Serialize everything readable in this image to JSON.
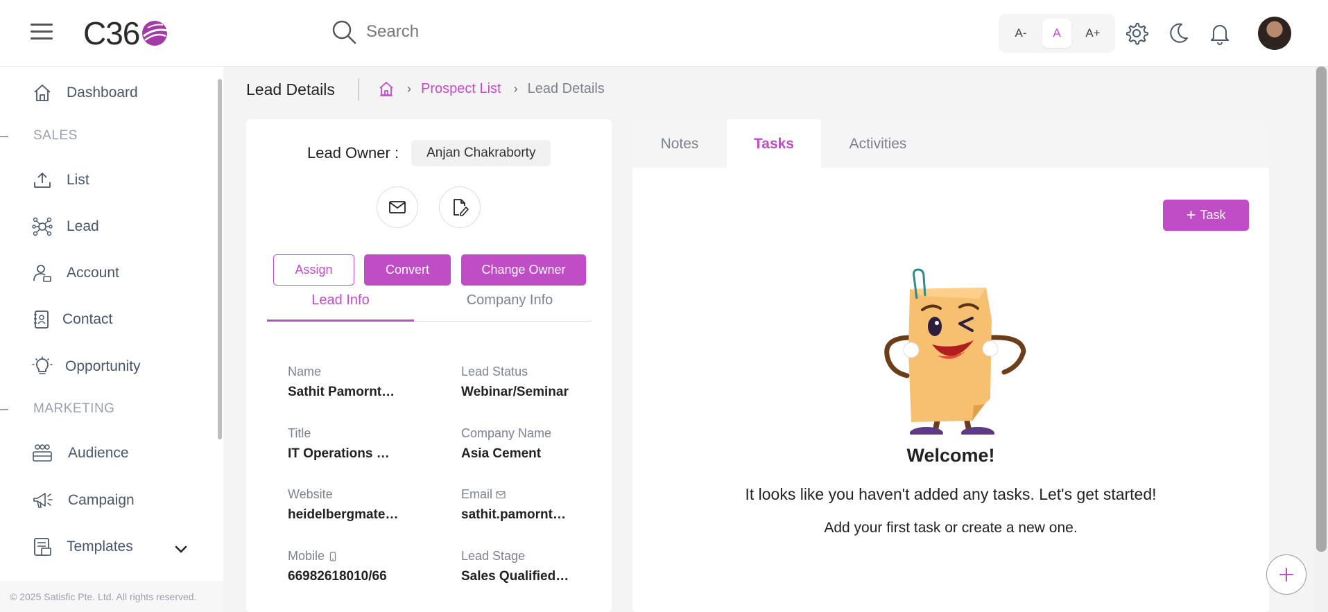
{
  "header": {
    "logo_text": "C36",
    "search_placeholder": "Search",
    "font_small": "A-",
    "font_normal": "A",
    "font_large": "A+"
  },
  "sidebar": {
    "items": [
      {
        "label": "Dashboard",
        "icon": "home-icon"
      },
      {
        "label": "List",
        "icon": "upload-icon"
      },
      {
        "label": "Lead",
        "icon": "lead-network-icon"
      },
      {
        "label": "Account",
        "icon": "account-icon"
      },
      {
        "label": "Contact",
        "icon": "contact-icon"
      },
      {
        "label": "Opportunity",
        "icon": "bulb-icon"
      },
      {
        "label": "Audience",
        "icon": "audience-icon"
      },
      {
        "label": "Campaign",
        "icon": "megaphone-icon"
      },
      {
        "label": "Templates",
        "icon": "templates-icon"
      }
    ],
    "sections": [
      "SALES",
      "MARKETING"
    ],
    "footer": "© 2025 Satisfic Pte. Ltd. All rights reserved."
  },
  "page": {
    "title": "Lead Details",
    "breadcrumb": [
      "Prospect List",
      "Lead Details"
    ]
  },
  "lead": {
    "owner_label": "Lead Owner :",
    "owner_name": "Anjan Chakraborty",
    "buttons": {
      "assign": "Assign",
      "convert": "Convert",
      "change_owner": "Change Owner"
    },
    "tabs": [
      "Lead Info",
      "Company Info"
    ],
    "fields": [
      {
        "label": "Name",
        "value": "Sathit Pamorntanaporn"
      },
      {
        "label": "Lead Status",
        "value": "Webinar/Seminar"
      },
      {
        "label": "Title",
        "value": "IT Operations Manager"
      },
      {
        "label": "Company Name",
        "value": "Asia Cement"
      },
      {
        "label": "Website",
        "value": "heidelbergmaterials.com"
      },
      {
        "label": "Email",
        "value": "sathit.pamorntanaporn"
      },
      {
        "label": "Mobile",
        "value": "66982618010/66"
      },
      {
        "label": "Lead Stage",
        "value": "Sales Qualified Lead"
      }
    ]
  },
  "activity": {
    "tabs": [
      "Notes",
      "Tasks",
      "Activities"
    ],
    "add_task_label": "Task",
    "welcome": "Welcome!",
    "empty_message": "It looks like you haven't added any tasks. Let's get started!",
    "empty_sub": "Add your first task or create a new one."
  },
  "colors": {
    "accent": "#c04cc6",
    "text_muted": "#7c8290"
  }
}
